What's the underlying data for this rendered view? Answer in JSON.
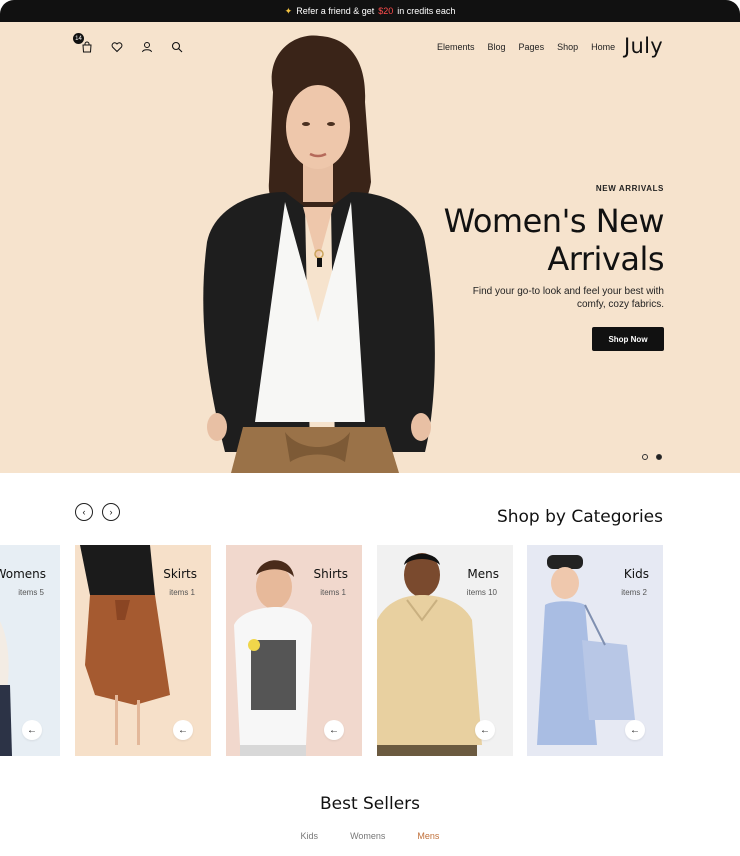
{
  "announcement": {
    "prefix": "Refer a friend & get",
    "amount": "$20",
    "suffix": "in credits each"
  },
  "header": {
    "cart_count": "14",
    "nav": [
      "Elements",
      "Blog",
      "Pages",
      "Shop",
      "Home"
    ],
    "logo": "July"
  },
  "hero": {
    "kicker": "NEW ARRIVALS",
    "title": "Women's New Arrivals",
    "subtitle": "Find your go-to look and feel your best with comfy, cozy fabrics.",
    "cta": "Shop Now",
    "slides": 2,
    "active_slide": 2
  },
  "categories": {
    "heading": "Shop by Categories",
    "prev_label": "‹",
    "next_label": "›",
    "items": [
      {
        "name": "Womens",
        "count": "items 5"
      },
      {
        "name": "Skirts",
        "count": "items 1"
      },
      {
        "name": "Shirts",
        "count": "items 1"
      },
      {
        "name": "Mens",
        "count": "items 10"
      },
      {
        "name": "Kids",
        "count": "items 2"
      }
    ]
  },
  "best_sellers": {
    "title": "Best Sellers",
    "tabs": [
      "Kids",
      "Womens",
      "Mens"
    ],
    "active_tab": "Mens"
  },
  "colors": {
    "hero_bg": "#f6e3cd",
    "dark": "#111111",
    "accent_tab": "#c0703a",
    "credit_red": "#ff4d4d"
  }
}
